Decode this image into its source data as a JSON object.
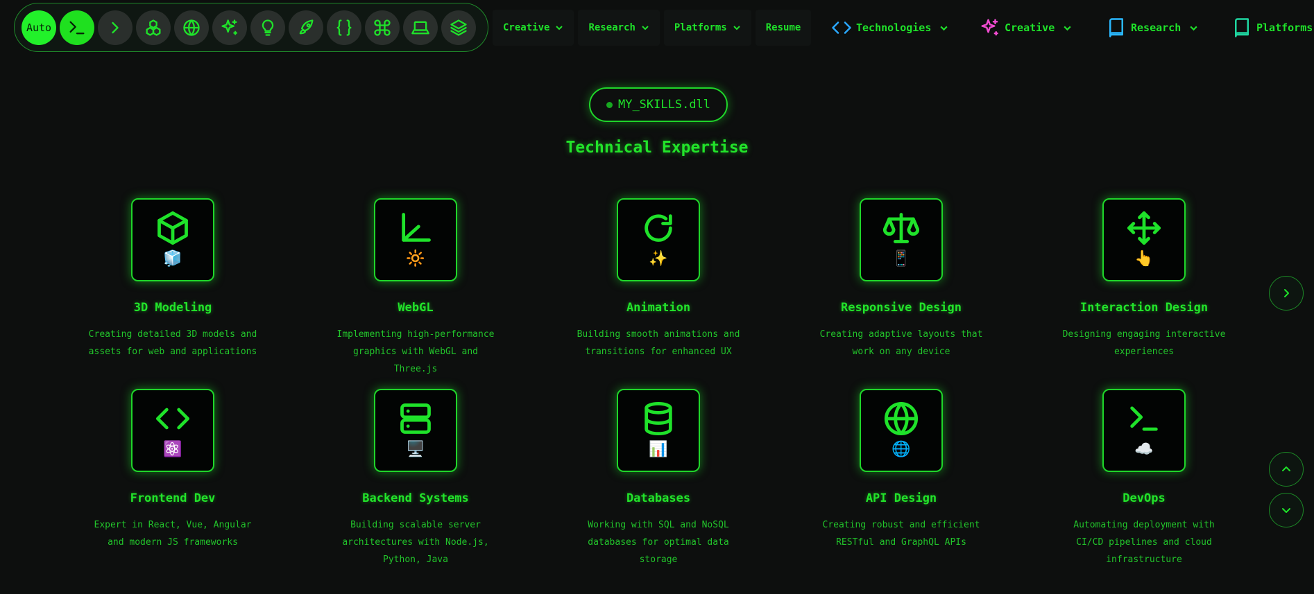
{
  "theme_switcher": {
    "auto_label": "Auto",
    "icons": [
      "terminal-icon",
      "chevron-right-icon",
      "boxes-icon",
      "globe-icon",
      "sparkles-icon",
      "lightbulb-icon",
      "rocket-icon",
      "braces-icon",
      "command-icon",
      "laptop-icon",
      "layers-icon"
    ]
  },
  "nav": {
    "items": [
      {
        "label": "Creative"
      },
      {
        "label": "Research"
      },
      {
        "label": "Platforms"
      },
      {
        "label": "Resume"
      }
    ],
    "secondary": [
      {
        "label": "Technologies",
        "color": "#2aa8ff"
      },
      {
        "label": "Creative",
        "color": "#f04bd0"
      },
      {
        "label": "Research",
        "color": "#2ab8ff"
      },
      {
        "label": "Platforms",
        "color": "#1fd6a0"
      }
    ]
  },
  "header": {
    "badge": "MY_SKILLS.dll",
    "title": "Technical Expertise"
  },
  "skills": [
    {
      "name": "3D Modeling",
      "icon": "cube-icon",
      "emoji": "🧊",
      "desc": "Creating detailed 3D models and assets for web and applications"
    },
    {
      "name": "WebGL",
      "icon": "axis-icon",
      "emoji": "🔆",
      "desc": "Implementing high-performance graphics with WebGL and Three.js"
    },
    {
      "name": "Animation",
      "icon": "refresh-icon",
      "emoji": "✨",
      "desc": "Building smooth animations and transitions for enhanced UX"
    },
    {
      "name": "Responsive Design",
      "icon": "scale-icon",
      "emoji": "📱",
      "desc": "Creating adaptive layouts that work on any device"
    },
    {
      "name": "Interaction Design",
      "icon": "move-icon",
      "emoji": "👆",
      "desc": "Designing engaging interactive experiences"
    },
    {
      "name": "Frontend Dev",
      "icon": "code-icon",
      "emoji": "⚛️",
      "desc": "Expert in React, Vue, Angular and modern JS frameworks"
    },
    {
      "name": "Backend Systems",
      "icon": "server-icon",
      "emoji": "🖥️",
      "desc": "Building scalable server architectures with Node.js, Python, Java"
    },
    {
      "name": "Databases",
      "icon": "database-icon",
      "emoji": "📊",
      "desc": "Working with SQL and NoSQL databases for optimal data storage"
    },
    {
      "name": "API Design",
      "icon": "globe-icon",
      "emoji": "🌐",
      "desc": "Creating robust and efficient RESTful and GraphQL APIs"
    },
    {
      "name": "DevOps",
      "icon": "terminal-icon",
      "emoji": "☁️",
      "desc": "Automating deployment with CI/CD pipelines and cloud infrastructure"
    }
  ]
}
